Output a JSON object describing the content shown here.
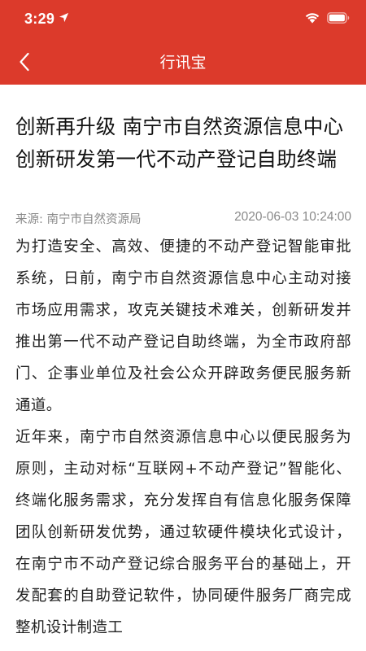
{
  "status_bar": {
    "time": "3:29",
    "location_icon": "location-arrow-icon",
    "wifi_icon": "wifi-icon",
    "battery_icon": "battery-icon"
  },
  "nav": {
    "back_icon": "chevron-left-icon",
    "title": "行讯宝"
  },
  "colors": {
    "header_bg": "#dc3a2b",
    "meta_text": "#8a8a8a"
  },
  "article": {
    "title": "创新再升级 南宁市自然资源信息中心创新研发第一代不动产登记自助终端",
    "source": "来源: 南宁市自然资源局",
    "date": "2020-06-03 10:24:00",
    "paragraphs": [
      "为打造安全、高效、便捷的不动产登记智能审批系统，日前，南宁市自然资源信息中心主动对接市场应用需求，攻克关键技术难关，创新研发并推出第一代不动产登记自助终端，为全市政府部门、企事业单位及社会公众开辟政务便民服务新通道。",
      "近年来，南宁市自然资源信息中心以便民服务为原则，主动对标“互联网+不动产登记”智能化、终端化服务需求，充分发挥自有信息化服务保障团队创新研发优势，通过软硬件模块化式设计，在南宁市不动产登记综合服务平台的基础上，开发配套的自助登记软件，协同硬件服务厂商完成整机设计制造工"
    ]
  }
}
